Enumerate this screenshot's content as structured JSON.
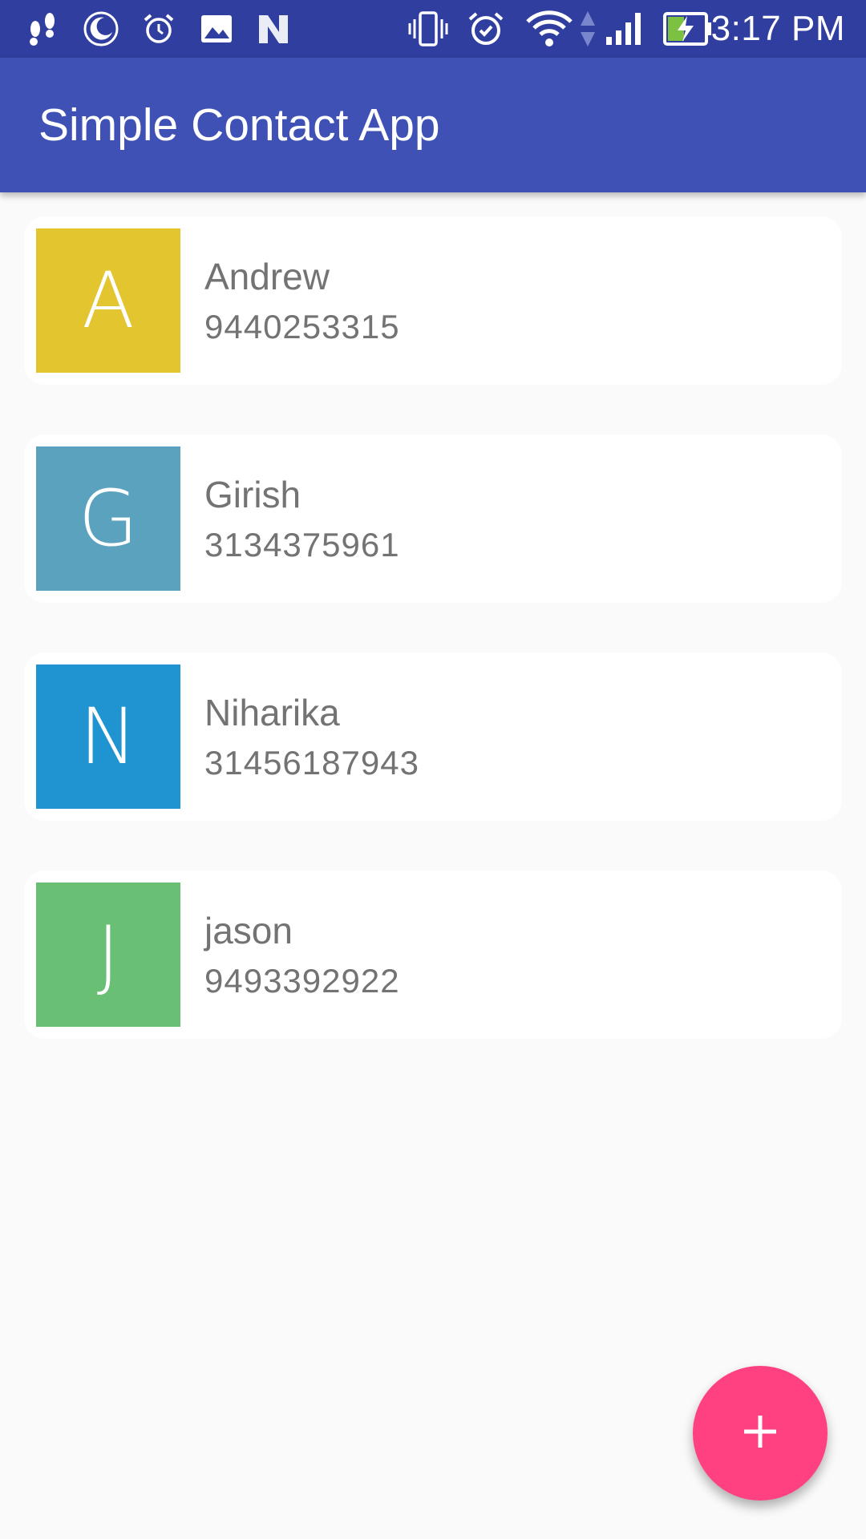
{
  "status_bar": {
    "time": "3:17 PM",
    "left_icons": [
      "footsteps-icon",
      "moon-icon",
      "alarm-clock-icon",
      "image-icon",
      "n-logo-icon"
    ],
    "right_icons": [
      "vibrate-icon",
      "alarm-icon",
      "wifi-icon",
      "data-arrows-icon",
      "signal-icon",
      "battery-charging-icon"
    ]
  },
  "app_bar": {
    "title": "Simple Contact App"
  },
  "contacts": [
    {
      "initial": "A",
      "name": "Andrew",
      "phone": "9440253315",
      "color": "#e2c52f"
    },
    {
      "initial": "G",
      "name": "Girish",
      "phone": "3134375961",
      "color": "#5aa2bd"
    },
    {
      "initial": "N",
      "name": "Niharika",
      "phone": "31456187943",
      "color": "#2094d0"
    },
    {
      "initial": "J",
      "name": "jason",
      "phone": "9493392922",
      "color": "#69c075"
    }
  ],
  "fab": {
    "icon": "plus-icon",
    "color": "#ff4081"
  }
}
